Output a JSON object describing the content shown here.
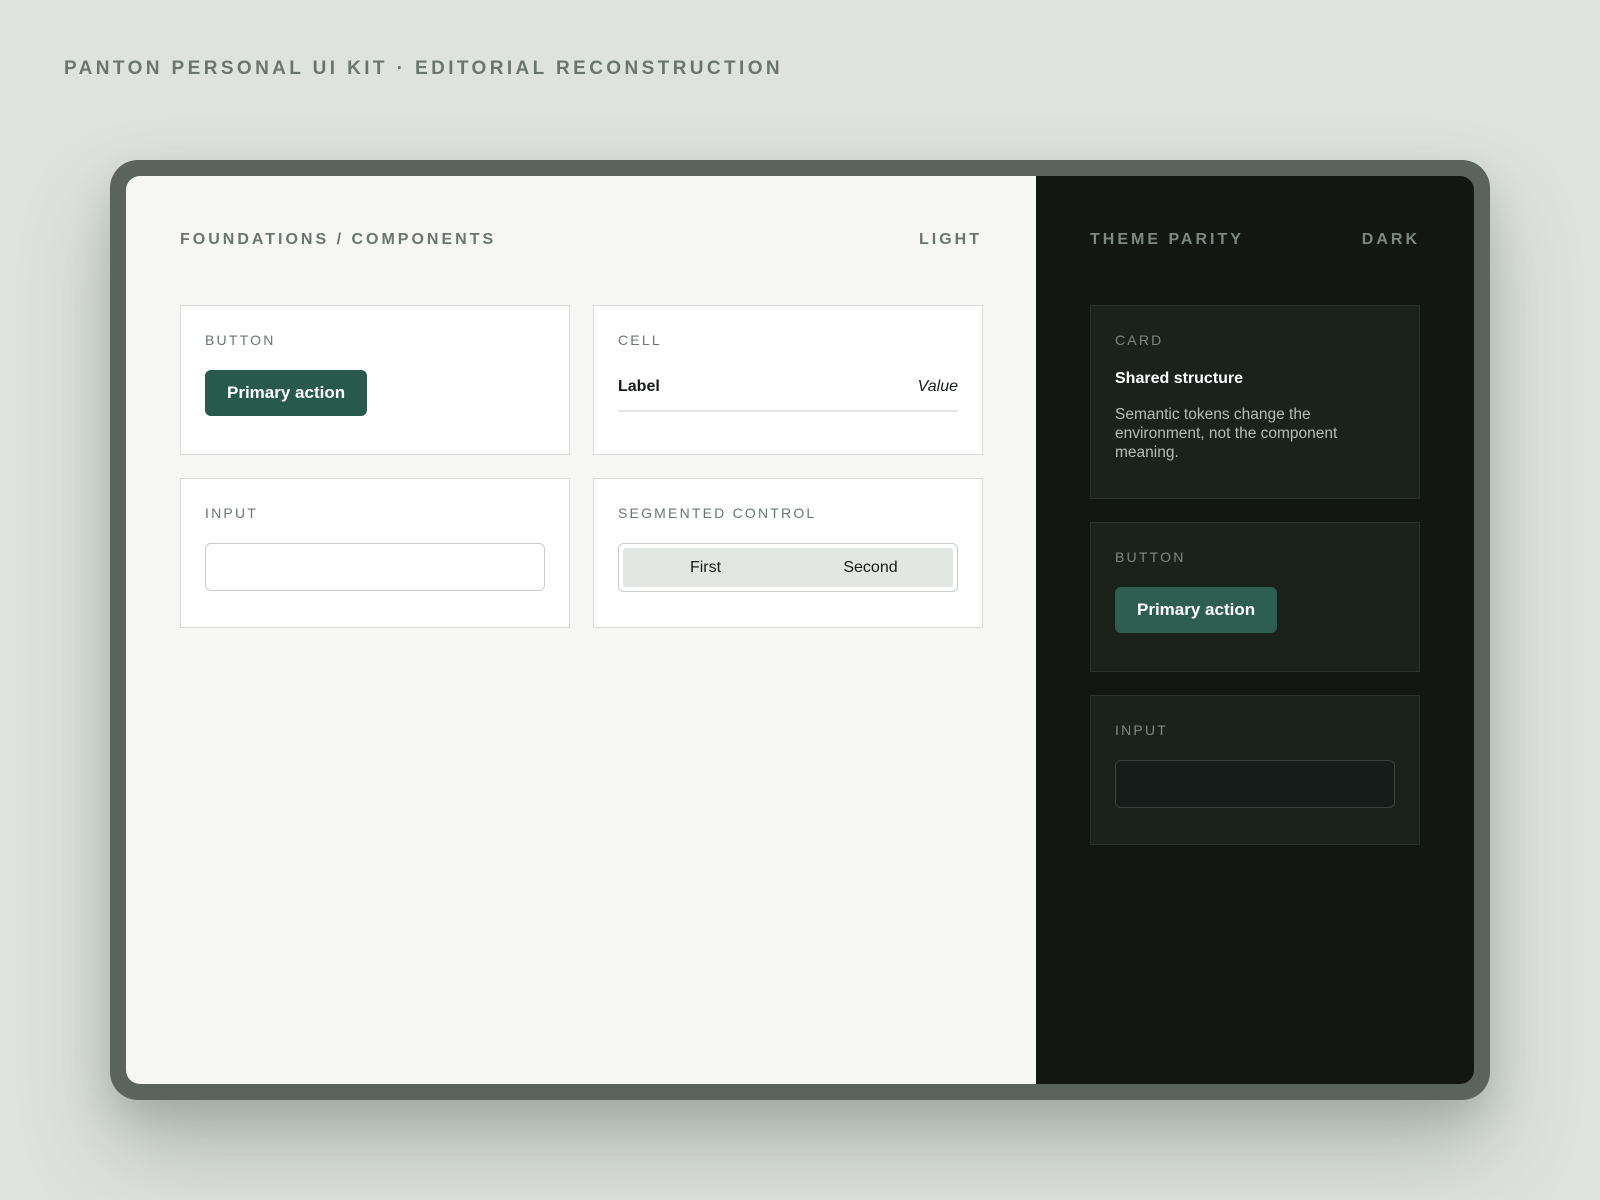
{
  "page": {
    "caption": "PANTON PERSONAL UI KIT · EDITORIAL RECONSTRUCTION"
  },
  "light": {
    "title": "FOUNDATIONS / COMPONENTS",
    "mode": "LIGHT",
    "button_card": {
      "label": "BUTTON",
      "button_label": "Primary action"
    },
    "cell_card": {
      "label": "CELL",
      "cell_label": "Label",
      "cell_value": "Value"
    },
    "input_card": {
      "label": "INPUT",
      "value": "",
      "placeholder": ""
    },
    "segmented_card": {
      "label": "SEGMENTED CONTROL",
      "segments": [
        "First",
        "Second"
      ]
    }
  },
  "dark": {
    "title": "THEME PARITY",
    "mode": "DARK",
    "card": {
      "label": "CARD",
      "heading": "Shared structure",
      "body": "Semantic tokens change the environment, not the component meaning."
    },
    "button_card": {
      "label": "BUTTON",
      "button_label": "Primary action"
    },
    "input_card": {
      "label": "INPUT",
      "value": "",
      "placeholder": ""
    }
  },
  "colors": {
    "page_background": "#dfe3df",
    "device_frame": "#5b635e",
    "light_surface": "#f6f6f4",
    "dark_surface": "#121714",
    "primary_button": "#285a4b",
    "muted_label": "#6b7570"
  }
}
